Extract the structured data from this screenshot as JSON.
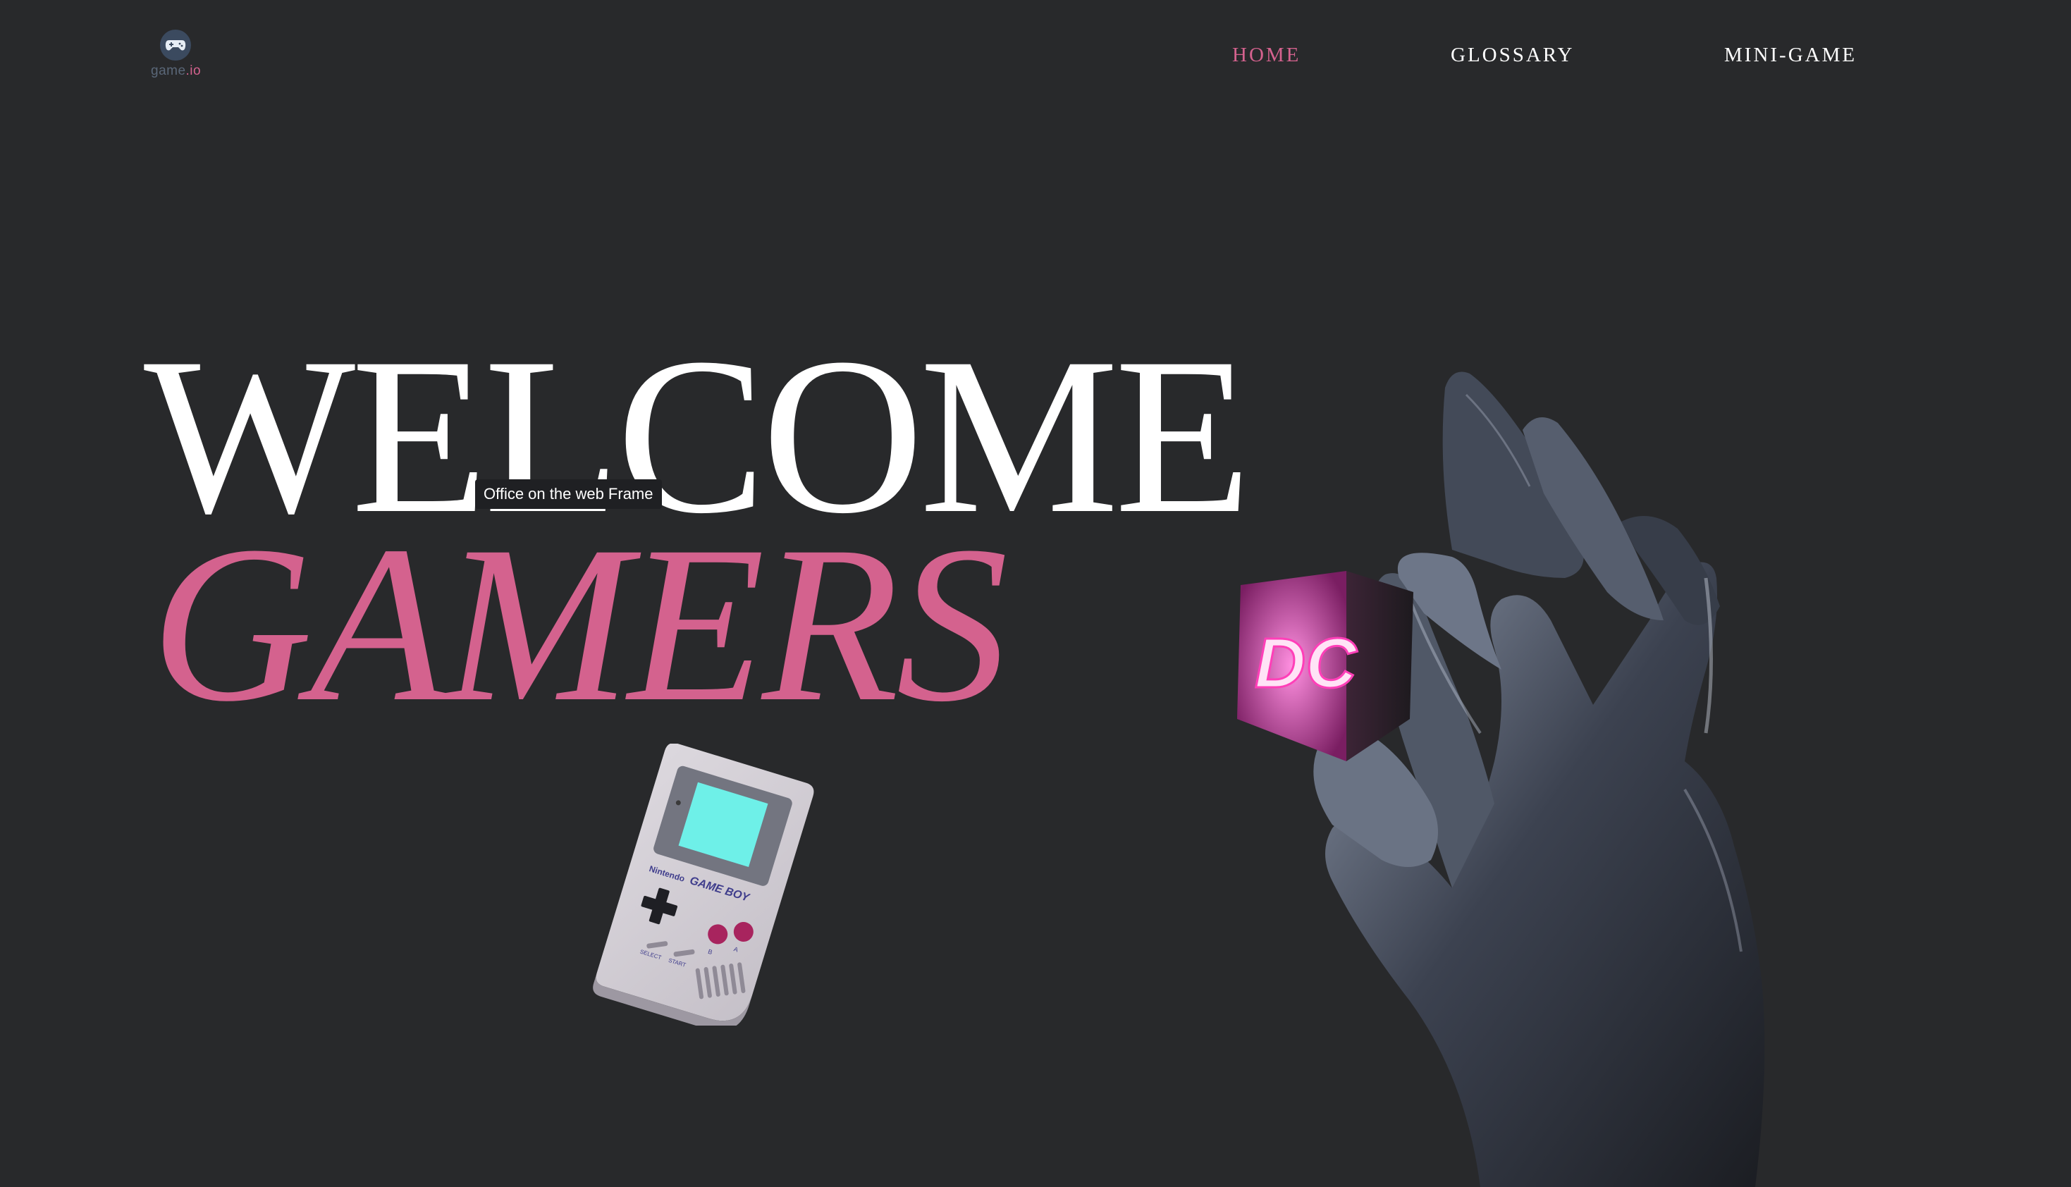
{
  "header": {
    "logo": {
      "text_main": "game",
      "text_accent": ".io",
      "icon": "gamepad-icon"
    },
    "nav": [
      {
        "label": "HOME",
        "active": true
      },
      {
        "label": "GLOSSARY",
        "active": false
      },
      {
        "label": "MINI-GAME",
        "active": false
      }
    ]
  },
  "hero": {
    "line1": "WELCOME",
    "line2": "GAMERS"
  },
  "tooltip": {
    "text": "Office on the web Frame"
  },
  "gameboy": {
    "brand": "Nintendo",
    "model": "GAME BOY",
    "select_label": "SELECT",
    "start_label": "START",
    "b_label": "B",
    "a_label": "A"
  },
  "cube": {
    "label": "DC"
  },
  "colors": {
    "background": "#28292b",
    "accent": "#d4628e",
    "text": "#ffffff",
    "gameboy_screen": "#6ef0e8",
    "cube_glow": "#ff6ad5"
  }
}
